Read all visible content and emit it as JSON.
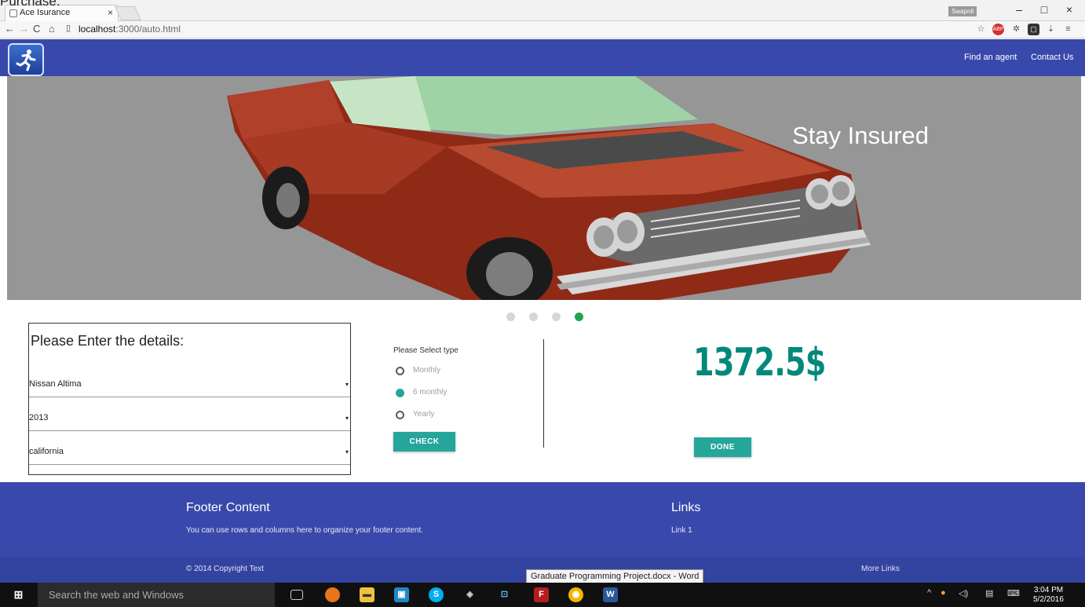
{
  "stray_text": "Purchase.",
  "browser": {
    "tab_title": "Ace Isurance",
    "tab_close": "×",
    "profile": "Swapnil",
    "url_host": "localhost",
    "url_path": ":3000/auto.html",
    "win_min": "–",
    "win_max": "□",
    "win_close": "×"
  },
  "nav": {
    "logo_icon": "running-man-icon",
    "links": [
      "Find an agent",
      "Contact Us"
    ]
  },
  "hero": {
    "caption": "Stay Insured",
    "slides_total": 4,
    "active_slide": 4
  },
  "form": {
    "title": "Please Enter the details:",
    "model": "Nissan Altima",
    "year": "2013",
    "state": "california",
    "caret": "▾"
  },
  "plan": {
    "label": "Please Select type",
    "options": [
      "Monthly",
      "6 monthly",
      "Yearly"
    ],
    "selected_index": 1,
    "check_button": "CHECK"
  },
  "quote": {
    "price": "1372.5$",
    "done_button": "DONE"
  },
  "footer": {
    "heading": "Footer Content",
    "text": "You can use rows and columns here to organize your footer content.",
    "links_heading": "Links",
    "link1": "Link 1",
    "copyright": "© 2014 Copyright Text",
    "more_links": "More Links"
  },
  "tooltip": "Graduate Programming Project.docx - Word",
  "taskbar": {
    "search_placeholder": "Search the web and Windows",
    "time": "3:04 PM",
    "date": "5/2/2016"
  },
  "colors": {
    "nav": "#3949ab",
    "accent": "#26a69a",
    "price": "#00897b",
    "active_dot": "#26a249"
  }
}
